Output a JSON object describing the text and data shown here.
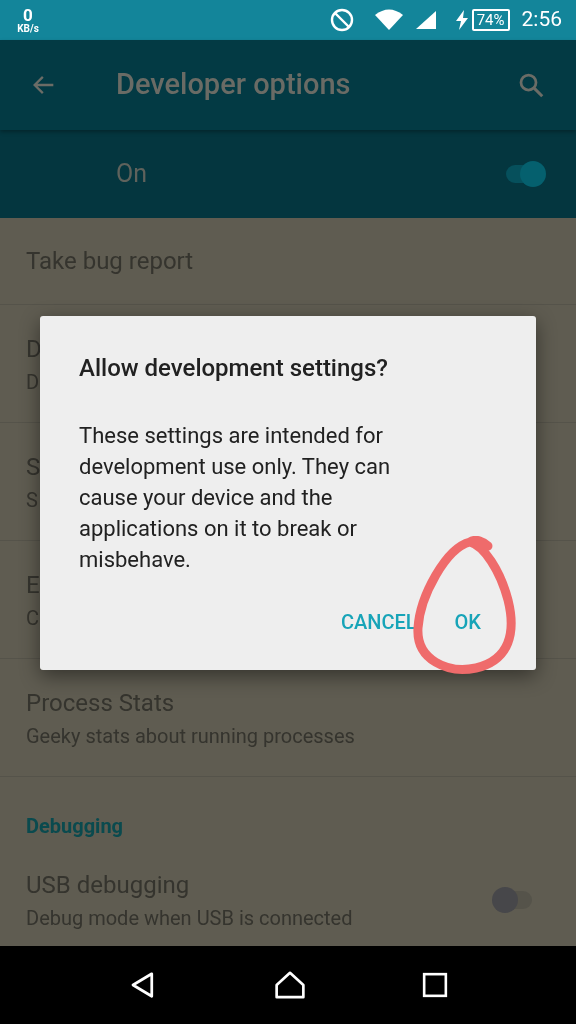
{
  "status_bar": {
    "speed_value": "0",
    "speed_unit": "KB/s",
    "battery": "74%",
    "charging": true,
    "time": "2:56"
  },
  "app_bar": {
    "title": "Developer options"
  },
  "master_switch": {
    "label": "On",
    "on": true
  },
  "list": [
    {
      "kind": "item",
      "title": "Take bug report"
    },
    {
      "kind": "item",
      "title": "D",
      "summary": "D"
    },
    {
      "kind": "item",
      "title": "S",
      "summary": "S"
    },
    {
      "kind": "item",
      "title": "E",
      "summary": "C"
    },
    {
      "kind": "item",
      "title": "Process Stats",
      "summary": "Geeky stats about running processes"
    },
    {
      "kind": "header",
      "title": "Debugging"
    },
    {
      "kind": "switch",
      "title": "USB debugging",
      "summary": "Debug mode when USB is connected",
      "on": false
    }
  ],
  "dialog": {
    "title": "Allow development settings?",
    "message": "These settings are intended for development use only. They can cause your device and the applications on it to break or misbehave.",
    "buttons": [
      "CANCEL",
      "OK"
    ]
  }
}
